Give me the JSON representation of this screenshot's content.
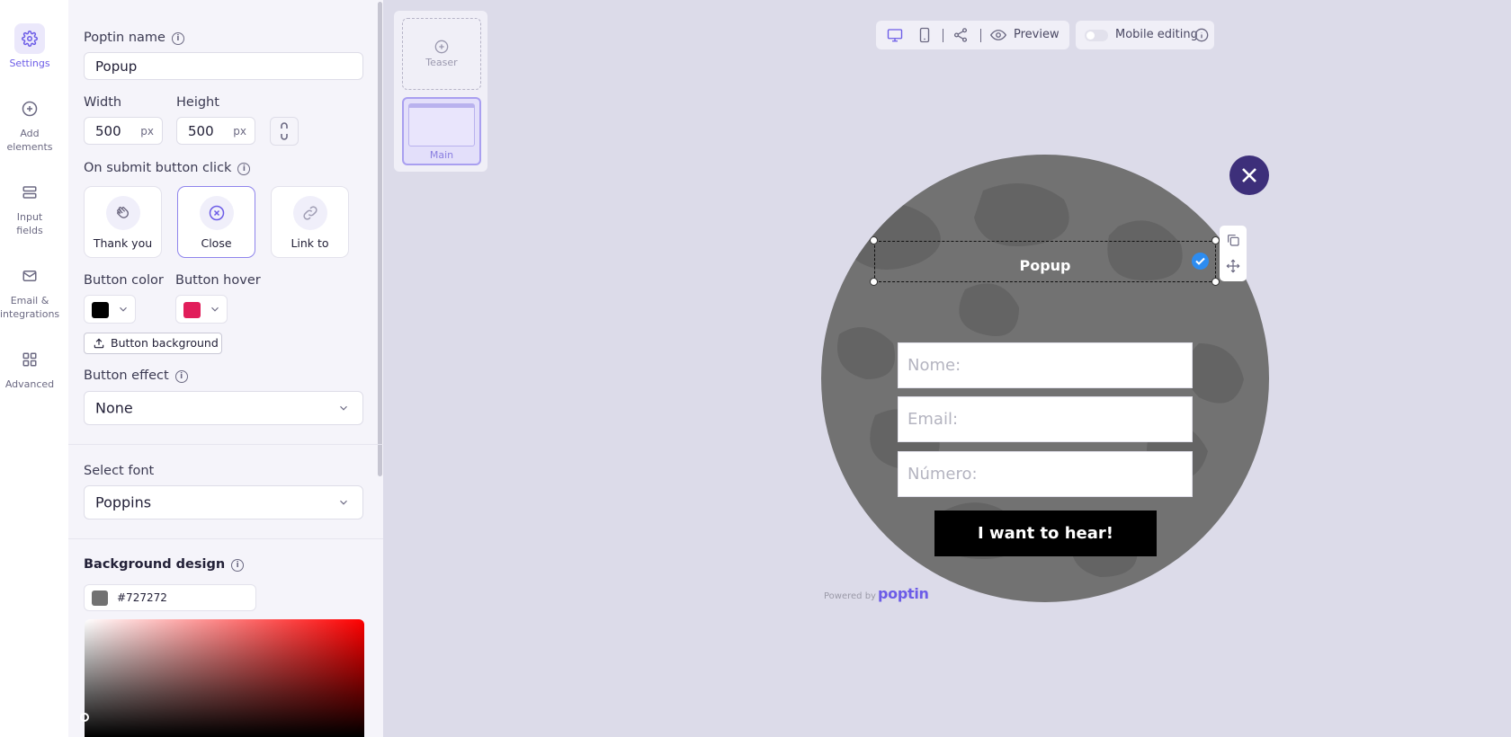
{
  "nav": [
    {
      "label": "Settings",
      "icon": "gear-icon"
    },
    {
      "label": "Add\nelements",
      "icon": "plus-circle-icon"
    },
    {
      "label": "Input\nfields",
      "icon": "input-fields-icon"
    },
    {
      "label": "Email &\nintegrations",
      "icon": "mail-icon"
    },
    {
      "label": "Advanced",
      "icon": "grid-icon"
    }
  ],
  "settings": {
    "name_label": "Poptin name",
    "name_value": "Popup",
    "width_label": "Width",
    "width_value": "500",
    "height_label": "Height",
    "height_value": "500",
    "unit": "px",
    "submit_label": "On submit button click",
    "submit_options": [
      "Thank you",
      "Close",
      "Link to"
    ],
    "selected_option": "Close",
    "button_color_label": "Button color",
    "button_color": "#000000",
    "button_hover_label": "Button hover",
    "button_hover": "#e11d5a",
    "button_background_label": "Button background",
    "button_effect_label": "Button effect",
    "button_effect_value": "None",
    "select_font_label": "Select font",
    "font_value": "Poppins",
    "background_design_label": "Background design",
    "background_hex": "#727272"
  },
  "pages": {
    "teaser_label": "Teaser",
    "main_label": "Main"
  },
  "toolbar": {
    "preview_label": "Preview",
    "mobile_editing_label": "Mobile editing"
  },
  "popup": {
    "title": "Popup",
    "fields": [
      "Nome:",
      "Email:",
      "Número:"
    ],
    "cta": "I want to hear!",
    "powered_by": "Powered by",
    "brand": "poptin"
  },
  "colors": {
    "accent": "#6c5ce7",
    "popup_bg": "#727272",
    "close_button": "#3d2f7a"
  }
}
